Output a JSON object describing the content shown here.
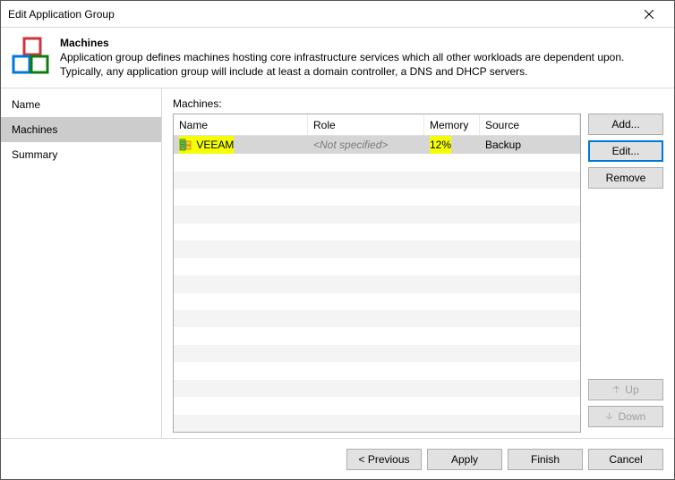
{
  "titlebar": {
    "text": "Edit Application Group"
  },
  "header": {
    "title": "Machines",
    "desc": "Application group defines machines hosting core infrastructure services which all other workloads are dependent upon. Typically, any application group will include at least a domain controller, a DNS and DHCP servers."
  },
  "sidebar": {
    "items": [
      {
        "label": "Name"
      },
      {
        "label": "Machines"
      },
      {
        "label": "Summary"
      }
    ],
    "selected_index": 1
  },
  "main": {
    "label": "Machines:",
    "columns": {
      "name": "Name",
      "role": "Role",
      "memory": "Memory",
      "source": "Source"
    },
    "rows": [
      {
        "name": "VEEAM",
        "role": "<Not specified>",
        "memory": "12%",
        "source": "Backup",
        "highlight": true
      }
    ]
  },
  "buttons": {
    "add": "Add...",
    "edit": "Edit...",
    "remove": "Remove",
    "up": "Up",
    "down": "Down"
  },
  "footer": {
    "previous": "< Previous",
    "apply": "Apply",
    "finish": "Finish",
    "cancel": "Cancel"
  }
}
